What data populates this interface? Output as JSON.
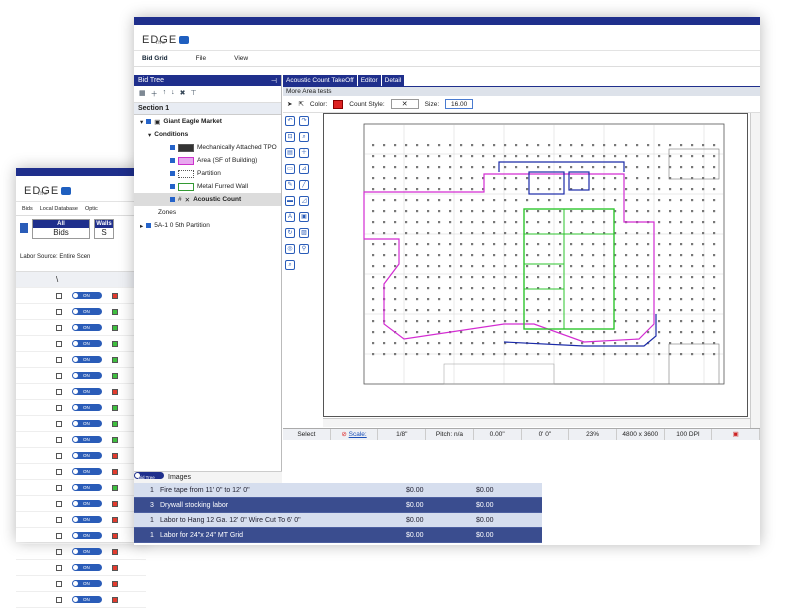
{
  "back_window": {
    "logo": {
      "small": "the",
      "main": "EDGE"
    },
    "menus": [
      "Bids",
      "Local Database",
      "Optic"
    ],
    "buttons": [
      {
        "top": "All",
        "bottom": "Bids"
      },
      {
        "top": "Walls",
        "bottom": "S"
      }
    ],
    "labor_source_label": "Labor Source:",
    "labor_source_value": "Entire Scen",
    "grid_header": "\\",
    "rows": [
      {
        "toggle": "ON",
        "color": "#e23b2e"
      },
      {
        "toggle": "ON",
        "color": "#3fbf3f"
      },
      {
        "toggle": "ON",
        "color": "#3fbf3f"
      },
      {
        "toggle": "ON",
        "color": "#3fbf3f"
      },
      {
        "toggle": "ON",
        "color": "#3fbf3f"
      },
      {
        "toggle": "ON",
        "color": "#3fbf3f"
      },
      {
        "toggle": "ON",
        "color": "#e23b2e"
      },
      {
        "toggle": "ON",
        "color": "#3fbf3f"
      },
      {
        "toggle": "ON",
        "color": "#3fbf3f"
      },
      {
        "toggle": "ON",
        "color": "#3fbf3f"
      },
      {
        "toggle": "ON",
        "color": "#e23b2e"
      },
      {
        "toggle": "ON",
        "color": "#e23b2e"
      },
      {
        "toggle": "ON",
        "color": "#3fbf3f"
      },
      {
        "toggle": "ON",
        "color": "#e23b2e"
      },
      {
        "toggle": "ON",
        "color": "#e23b2e"
      },
      {
        "toggle": "ON",
        "color": "#e23b2e"
      },
      {
        "toggle": "ON",
        "color": "#e23b2e"
      },
      {
        "toggle": "ON",
        "color": "#e23b2e"
      },
      {
        "toggle": "ON",
        "color": "#e23b2e"
      },
      {
        "toggle": "ON",
        "color": "#e23b2e"
      }
    ]
  },
  "front_window": {
    "logo": {
      "small": "the",
      "main": "EDGE"
    },
    "menus": [
      "Bid Grid",
      "File",
      "View"
    ],
    "bid_tree_title": "Bid Tree",
    "section": "Section 1",
    "tree": {
      "project": "Giant Eagle Market",
      "conditions_label": "Conditions",
      "conditions": [
        "Mechanically Attached TPO",
        "Area (SF of Building)",
        "Partition",
        "Metal Furred Wall",
        "Acoustic Count"
      ],
      "zones_label": "Zones",
      "zone": "5A-1 0 5th Partition"
    },
    "bottom_tabs": [
      "Bid Tree",
      "Images"
    ],
    "bid_items": [
      {
        "qty": "1",
        "text": "Fire tape from 11' 0\" to 12' 0\"",
        "amount": "$0.00",
        "amount2": "$0.00"
      },
      {
        "qty": "3",
        "text": "Drywall stocking labor",
        "amount": "$0.00",
        "amount2": "$0.00"
      },
      {
        "qty": "1",
        "text": "Labor to Hang 12 Ga. 12' 0\" Wire Cut To 6' 0\"",
        "amount": "$0.00",
        "amount2": "$0.00"
      },
      {
        "qty": "1",
        "text": "Labor for 24\"x 24\" MT Grid",
        "amount": "$0.00",
        "amount2": "$0.00"
      }
    ],
    "main_tabs": [
      "Acoustic Count TakeOff",
      "Editor",
      "Detail"
    ],
    "strip": "More Area tests",
    "options": {
      "color_label": "Color:",
      "count_style_label": "Count Style:",
      "count_style_value": "✕",
      "size_label": "Size:",
      "size_value": "16.00"
    },
    "status": [
      "Select",
      "Scale:",
      "1/8\"",
      "Pitch: n/a",
      "0.00\"",
      "0' 0\"",
      "23%",
      "4800 x 3600",
      "100 DPI"
    ]
  }
}
